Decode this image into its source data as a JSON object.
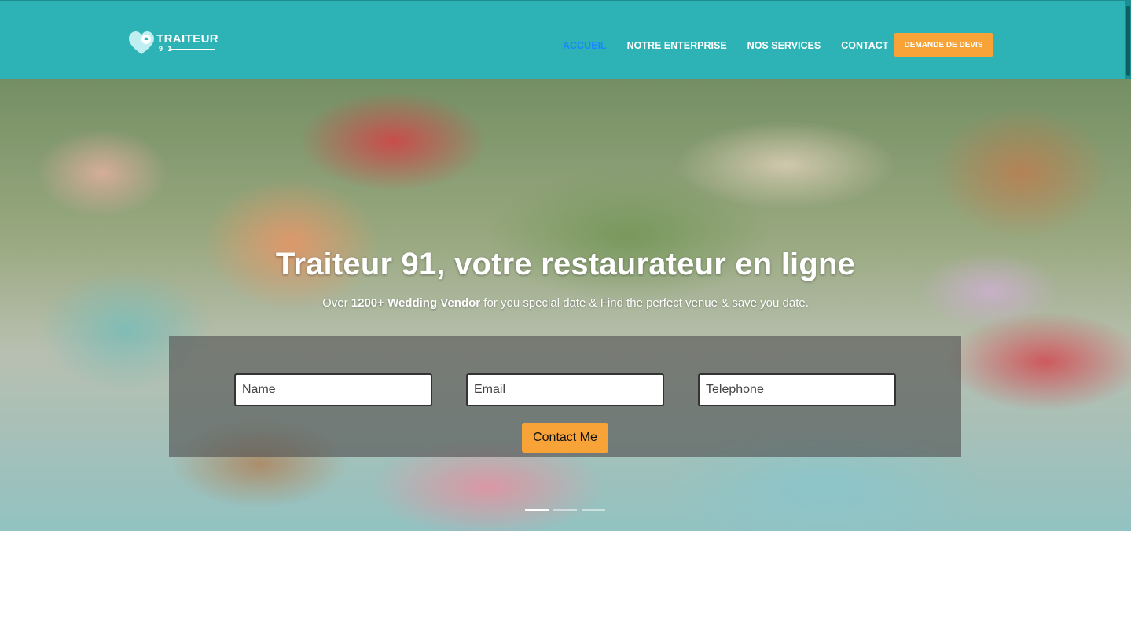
{
  "brand": {
    "name": "TRAITEUR",
    "number": "9 1",
    "logo_icon": "heart-map-pin-icon"
  },
  "nav": {
    "items": [
      {
        "label": "ACCUEIL",
        "active": true
      },
      {
        "label": "NOTRE ENTERPRISE",
        "active": false
      },
      {
        "label": "NOS SERVICES",
        "active": false
      },
      {
        "label": "CONTACT",
        "active": false
      }
    ],
    "cta_label": "DEMANDE DE DEVIS"
  },
  "hero": {
    "title": "Traiteur 91, votre restaurateur en ligne",
    "subtitle_prefix": "Over ",
    "subtitle_highlight": "1200+ Wedding Vendor",
    "subtitle_suffix": " for you special date & Find the perfect venue & save you date."
  },
  "form": {
    "name_placeholder": "Name",
    "email_placeholder": "Email",
    "telephone_placeholder": "Telephone",
    "submit_label": "Contact Me"
  },
  "carousel": {
    "slides": 3,
    "active_index": 0
  },
  "colors": {
    "nav_bg": "#2db3b5",
    "accent_orange": "#f7a338",
    "active_link": "#1a86ff"
  }
}
